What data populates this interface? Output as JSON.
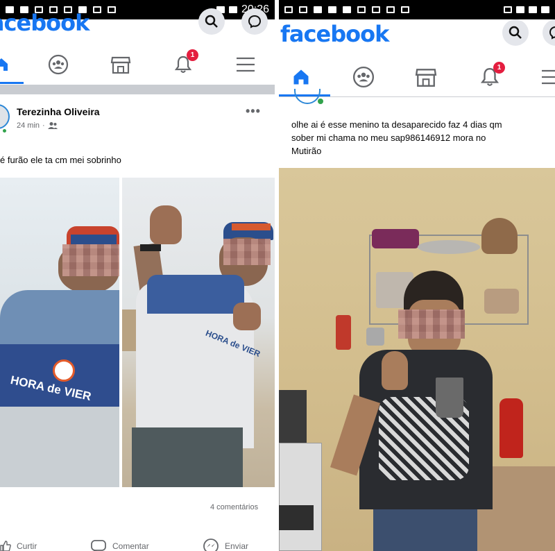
{
  "left": {
    "status_time": "20:26",
    "logo": "facebook",
    "notification_count": "1",
    "post": {
      "author": "Terezinha Oliveira",
      "time": "24 min",
      "text": "é furão ele ta cm mei sobrinho",
      "photo_shirt_text": "HORA de VIER",
      "comments": "4 comentários"
    },
    "actions": {
      "like": "Curtir",
      "comment": "Comentar",
      "send": "Enviar"
    }
  },
  "right": {
    "logo": "facebook",
    "notification_count": "1",
    "post": {
      "text_line1": "olhe ai é  esse menino ta desaparecido faz 4 dias qm",
      "text_line2": "sober mi chama no meu sap986146912 mora no",
      "text_line3": "Mutirão"
    }
  },
  "colors": {
    "brand": "#1877f2",
    "badge": "#e41e3f",
    "separator": "#c9ccd1"
  },
  "icons": {
    "home": "home-icon",
    "groups": "groups-icon",
    "marketplace": "marketplace-icon",
    "notifications": "bell-icon",
    "menu": "hamburger-menu-icon",
    "search": "search-icon",
    "messenger": "messenger-icon"
  }
}
